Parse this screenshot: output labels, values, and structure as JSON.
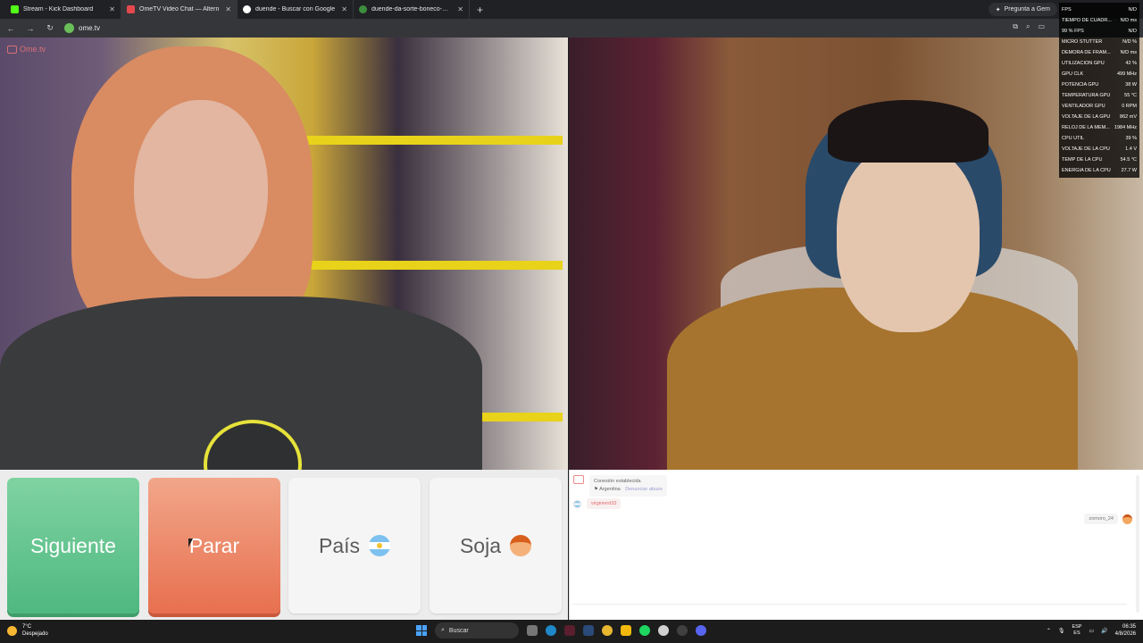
{
  "browser": {
    "tabs": [
      {
        "title": "Stream - Kick Dashboard",
        "color": "#53fc18",
        "active": false
      },
      {
        "title": "OmeTV Video Chat — Altern",
        "color": "#e5484d",
        "active": true
      },
      {
        "title": "duende - Buscar con Google",
        "color": "#ffffff",
        "active": false
      },
      {
        "title": "duende-da-sorte-boneco-misi",
        "color": "#3c8d3c",
        "active": false
      }
    ],
    "ask_label": "Pregunta a Gem",
    "url": "ome.tv"
  },
  "osd": {
    "rows": [
      {
        "label": "FPS",
        "value": "N/D"
      },
      {
        "label": "TIEMPO DE CUADR...",
        "value": "N/D ms"
      },
      {
        "label": "99 % FPS",
        "value": "N/D"
      },
      {
        "label": "MICRO STUTTER",
        "value": "N/D %"
      },
      {
        "label": "DEMORA DE FRAM...",
        "value": "N/D ms"
      },
      {
        "label": "UTILIZACIÓN GPU",
        "value": "42 %"
      },
      {
        "label": "GPU CLK",
        "value": "499 MHz"
      },
      {
        "label": "POTENCIA GPU",
        "value": "38 W"
      },
      {
        "label": "TEMPERATURA GPU",
        "value": "55 °C"
      },
      {
        "label": "VENTILADOR GPU",
        "value": "0 RPM"
      },
      {
        "label": "VOLTAJE DE LA GPU",
        "value": "862 mV"
      },
      {
        "label": "RELOJ DE LA MEM...",
        "value": "1984 MHz"
      },
      {
        "label": "CPU UTIL",
        "value": "39 %"
      },
      {
        "label": "VOLTAJE DE LA CPU",
        "value": "1.4 V"
      },
      {
        "label": "TEMP DE LA CPU",
        "value": "54.5 °C"
      },
      {
        "label": "ENERGÍA DE LA CPU",
        "value": "27.7 W"
      }
    ]
  },
  "video": {
    "brand": "Ome.tv"
  },
  "controls": {
    "next_label": "Siguiente",
    "stop_label": "Parar",
    "country_label": "País",
    "gender_label": "Soja"
  },
  "chat": {
    "system_line1": "Conexión establecida",
    "system_country": "Argentina",
    "report_label": "Denunciar abuso",
    "incoming": "virginierd33",
    "outgoing": "zomoro_24"
  },
  "taskbar": {
    "temp": "7°C",
    "weather": "Despejado",
    "search_label": "Buscar",
    "lang_top": "ESP",
    "lang_bottom": "ES",
    "time": "06:35",
    "date": "4/8/2026"
  }
}
